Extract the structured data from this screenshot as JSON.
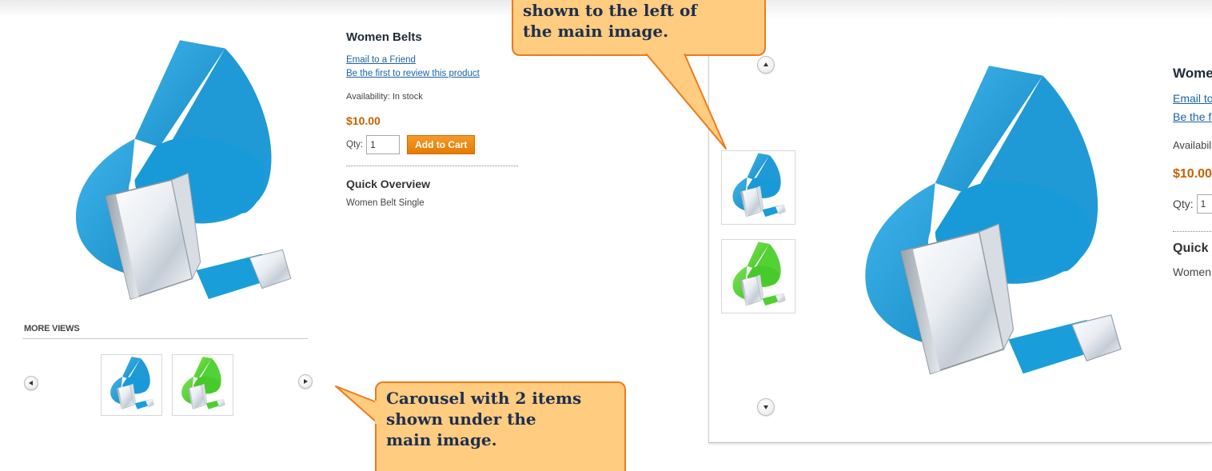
{
  "product": {
    "title": "Women Belts",
    "email_link": "Email to a Friend",
    "review_link": "Be the first to review this product",
    "availability": "Availability: In stock",
    "price": "$10.00",
    "qty_label": "Qty:",
    "qty_value": "1",
    "add_to_cart": "Add to Cart",
    "quick_overview": "Quick Overview",
    "description": "Women Belt Single"
  },
  "gallery": {
    "more_views_label": "MORE VIEWS",
    "thumbnails": [
      {
        "name": "blue belt",
        "color": "#2aa3dc"
      },
      {
        "name": "green belt",
        "color": "#5fd93a"
      }
    ]
  },
  "callouts": {
    "top": [
      "shown to the left of",
      "the main image."
    ],
    "bottom": [
      "Carousel with 2 items",
      "shown under the",
      "main image."
    ]
  },
  "colors": {
    "callout_fill": "#ffcc80",
    "callout_border": "#ef7a1e",
    "callout_text": "#1f2f4f",
    "link": "#1a63a8",
    "price": "#c76200",
    "add_to_cart": "#f08a10",
    "belt_blue": "#2aa3dc",
    "belt_green": "#5fd93a"
  }
}
